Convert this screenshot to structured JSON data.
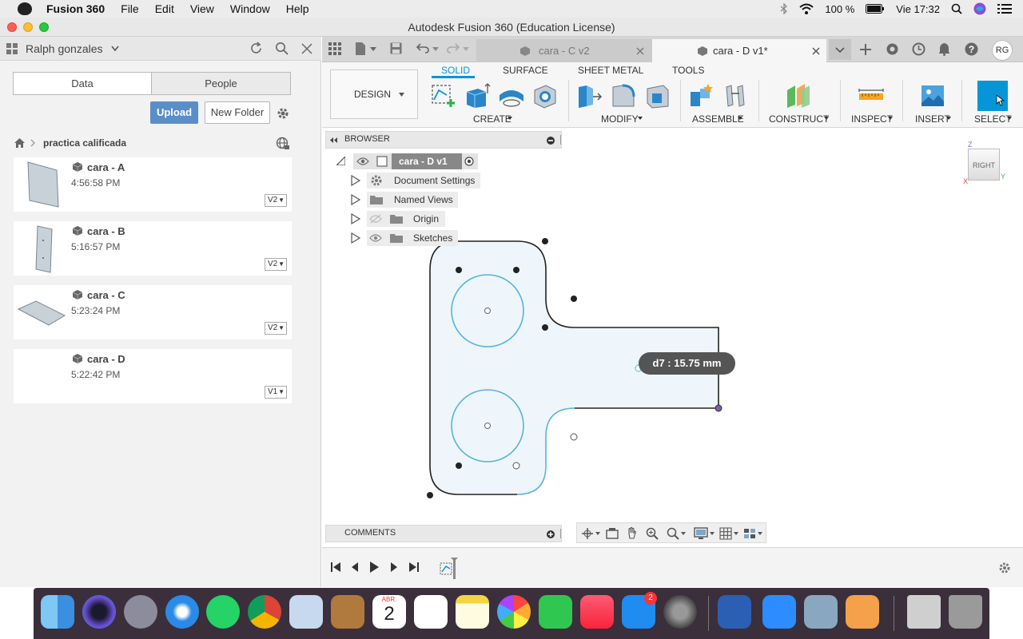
{
  "menubar": {
    "app_name": "Fusion 360",
    "items": [
      "File",
      "Edit",
      "View",
      "Window",
      "Help"
    ],
    "battery": "100 %",
    "clock": "Vie 17:32"
  },
  "window": {
    "title": "Autodesk Fusion 360 (Education License)"
  },
  "data_panel": {
    "user": "Ralph gonzales",
    "tabs": [
      "Data",
      "People"
    ],
    "upload": "Upload",
    "new_folder": "New Folder",
    "breadcrumb": "practica calificada",
    "files": [
      {
        "name": "cara - A",
        "time": "4:56:58 PM",
        "version": "V2"
      },
      {
        "name": "cara - B",
        "time": "5:16:57 PM",
        "version": "V2"
      },
      {
        "name": "cara - C",
        "time": "5:23:24 PM",
        "version": "V2"
      },
      {
        "name": "cara - D",
        "time": "5:22:42 PM",
        "version": "V1"
      }
    ]
  },
  "doc_tabs": [
    {
      "label": "cara - C v2",
      "active": false
    },
    {
      "label": "cara - D v1*",
      "active": true
    }
  ],
  "user_initials": "RG",
  "ribbon": {
    "workspace": "DESIGN",
    "tabs": [
      "SOLID",
      "SURFACE",
      "SHEET METAL",
      "TOOLS"
    ],
    "groups": [
      "CREATE",
      "MODIFY",
      "ASSEMBLE",
      "CONSTRUCT",
      "INSPECT",
      "INSERT",
      "SELECT"
    ]
  },
  "browser": {
    "title": "BROWSER",
    "root": "cara - D v1",
    "items": [
      "Document Settings",
      "Named Views",
      "Origin",
      "Sketches"
    ]
  },
  "viewcube": {
    "face": "RIGHT",
    "axis_z": "Z",
    "axis_y": "Y",
    "axis_x": "X"
  },
  "dimension": {
    "label": "d7 : 15.75 mm"
  },
  "comments": {
    "title": "COMMENTS"
  },
  "dock": {
    "calendar_month": "ABR.",
    "calendar_day": "2",
    "appstore_badge": "2"
  },
  "colors": {
    "accent": "#0696d7",
    "sketch_blue": "#56b4dc",
    "upload_blue": "#5a8ec8"
  }
}
